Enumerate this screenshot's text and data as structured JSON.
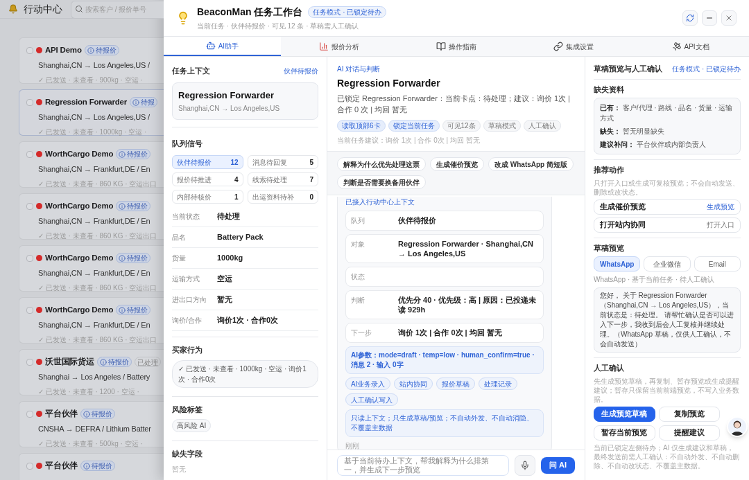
{
  "background": {
    "title": "行动中心",
    "search": {
      "placeholder": "搜索客户 / 报价单号"
    },
    "cards": [
      {
        "name": "API Demo",
        "badge": "待报价",
        "route": "Shanghai,CN → Los Angeles,US /",
        "meta": "✓ 已发送 · 未查看 · 900kg · 空运 ·",
        "selected": false,
        "checked": false
      },
      {
        "name": "Regression Forwarder",
        "badge": "待报",
        "route": "Shanghai,CN → Los Angeles,US /",
        "meta": "✓ 已发送 · 未查看 · 1000kg · 空运 ·",
        "selected": true,
        "checked": false
      },
      {
        "name": "WorthCargo Demo",
        "badge": "待报价",
        "route": "Shanghai,CN → Frankfurt,DE / En",
        "meta": "✓ 已发送 · 未查看 · 860 KG · 空运出口",
        "selected": false,
        "checked": false
      },
      {
        "name": "WorthCargo Demo",
        "badge": "待报价",
        "route": "Shanghai,CN → Frankfurt,DE / En",
        "meta": "✓ 已发送 · 未查看 · 860 KG · 空运出口",
        "selected": false,
        "checked": false
      },
      {
        "name": "WorthCargo Demo",
        "badge": "待报价",
        "route": "Shanghai,CN → Frankfurt,DE / En",
        "meta": "✓ 已发送 · 未查看 · 860 KG · 空运出口",
        "selected": false,
        "checked": false
      },
      {
        "name": "WorthCargo Demo",
        "badge": "待报价",
        "route": "Shanghai,CN → Frankfurt,DE / En",
        "meta": "✓ 已发送 · 未查看 · 860 KG · 空运出口",
        "selected": false,
        "checked": false
      },
      {
        "name": "沃世国际货运",
        "badge": "待报价",
        "extra": "已处理",
        "route": "Shanghai → Los Angeles / Battery",
        "meta": "✓ 已发送 · 未查看 · 1200 · 空运 ·",
        "selected": false,
        "checked": false
      },
      {
        "name": "平台伙伴",
        "badge": "待报价",
        "route": "CNSHA → DEFRA / Lithium Batter",
        "meta": "✓ 已发送 · 未查看 · 500kg · 空运 ·",
        "selected": false,
        "checked": false
      },
      {
        "name": "平台伙伴",
        "badge": "待报价",
        "selected": false,
        "checked": false
      }
    ]
  },
  "header": {
    "title": "BeaconMan 任务工作台",
    "badge": "任务模式 · 已锁定待办",
    "subtitle": "当前任务 · 伙伴待报价 · 可见 12 条 · 草稿需人工确认"
  },
  "tabs": [
    {
      "label": "AI助手",
      "kind": "bot",
      "selected": true
    },
    {
      "label": "报价分析",
      "kind": "chart",
      "selected": false
    },
    {
      "label": "操作指南",
      "kind": "book",
      "selected": false
    },
    {
      "label": "集成设置",
      "kind": "link",
      "selected": false
    },
    {
      "label": "API文档",
      "kind": "satellite",
      "selected": false
    }
  ],
  "context": {
    "title": "任务上下文",
    "link": "伙伴待报价",
    "card": {
      "name": "Regression Forwarder",
      "route": "Shanghai,CN → Los Angeles,US"
    },
    "signals_title": "队列信号",
    "signals": [
      {
        "label": "伙伴待报价",
        "count": "12",
        "selected": true
      },
      {
        "label": "消息待回复",
        "count": "5",
        "selected": false
      },
      {
        "label": "报价待推进",
        "count": "4",
        "selected": false
      },
      {
        "label": "线索待处理",
        "count": "7",
        "selected": false
      },
      {
        "label": "内部待核价",
        "count": "1",
        "selected": false
      },
      {
        "label": "出运资料待补",
        "count": "0",
        "selected": false
      }
    ],
    "fields": [
      {
        "label": "当前状态",
        "value": "待处理"
      },
      {
        "label": "品名",
        "value": "Battery Pack"
      },
      {
        "label": "货量",
        "value": "1000kg"
      },
      {
        "label": "运输方式",
        "value": "空运"
      },
      {
        "label": "进出口方向",
        "value": "暂无"
      },
      {
        "label": "询价/合作",
        "value": "询价1次 · 合作0次"
      }
    ],
    "behavior": {
      "title": "买家行为",
      "chip": "✓ 已发送 · 未查看 · 1000kg · 空运 · 询价1次 · 合作0次"
    },
    "risk": {
      "title": "风险标签",
      "tags": [
        "高风险 AI"
      ]
    },
    "missing": {
      "title": "缺失字段",
      "value": "暂无"
    }
  },
  "chat": {
    "eyebrow": "AI 对话与判断",
    "title": "Regression Forwarder",
    "summary": "已锁定 Regression Forwarder：当前卡点：待处理；建议：询价 1次 | 合作 0 次 | 均回 暂无",
    "chips": [
      {
        "label": "读取顶部6卡",
        "active": true
      },
      {
        "label": "锁定当前任务",
        "active": true
      },
      {
        "label": "可见12条",
        "active": false
      },
      {
        "label": "草稿模式",
        "active": false
      },
      {
        "label": "人工确认",
        "active": false
      }
    ],
    "hint": "当前任务建议：询价 1次 | 合作 0次 | 均回 暂无",
    "prompts": [
      "解释为什么优先处理这票",
      "生成催价预览",
      "改成 WhatsApp 简短版",
      "判断是否需要换备用伙伴"
    ],
    "message": {
      "header": "已接入行动中心上下文",
      "rows": [
        {
          "label": "队列",
          "value": "伙伴待报价"
        },
        {
          "label": "对象",
          "value": "Regression Forwarder · Shanghai,CN → Los Angeles,US"
        },
        {
          "label": "状态"
        },
        {
          "label": "判断",
          "value": "优先分 40 · 优先级：高 | 原因：已投递未读 929h"
        },
        {
          "label": "下一步",
          "value": "询价 1次 | 合作 0次 | 均回 暂无"
        }
      ],
      "params": "AI参数：mode=draft · temp=low · human_confirm=true · 消息 2 · 输入 0字",
      "actions": [
        "AI业务录入",
        "站内协同",
        "报价草稿",
        "处理记录",
        "人工确认写入"
      ],
      "note": "只读上下文；只生成草稿/预览；不自动外发、不自动消隐、不覆盖主数据",
      "time": "刚刚"
    },
    "input": {
      "placeholder": "基于当前待办上下文，帮我解释为什么排第一，并生成下一步预览"
    },
    "send": "问 AI"
  },
  "draft": {
    "title": "草稿预览与人工确认",
    "mode": "任务模式 · 已锁定待办",
    "missing": {
      "title": "缺失资料",
      "lines": [
        {
          "label": "已有：",
          "value": "客户/代理 · 路线 · 品名 · 货量 · 运输方式"
        },
        {
          "label": "缺失：",
          "value": "暂无明显缺失"
        },
        {
          "label": "建议补问：",
          "value": "平台伙伴或内部负责人"
        }
      ]
    },
    "actions": {
      "title": "推荐动作",
      "desc": "只打开入口或生成可复核预览；不会自动发送、删除或改状态。",
      "items": [
        {
          "label": "生成催价预览",
          "action": "生成预览",
          "primary": true
        },
        {
          "label": "打开站内协同",
          "action": "打开入口",
          "primary": false
        }
      ]
    },
    "preview": {
      "title": "草稿预览",
      "channels": [
        {
          "label": "WhatsApp",
          "selected": true
        },
        {
          "label": "企业微信",
          "selected": false
        },
        {
          "label": "Email",
          "selected": false
        }
      ],
      "caption": "WhatsApp · 基于当前任务 · 待人工确认",
      "text": "您好， 关于 Regression Forwarder（Shanghai,CN → Los Angeles,US），当前状态是：待处理。 请帮忙确认是否可以进入下一步，我收到后会人工复核并继续处理。（WhatsApp 草稿，仅供人工确认，不会自动发送）"
    },
    "confirm": {
      "title": "人工确认",
      "desc": "先生成预览草稿，再复制、暂存预览或生成提醒建议；暂存只保留当前前端预览，不写入业务数据。",
      "buttons": [
        {
          "label": "生成预览草稿",
          "primary": true
        },
        {
          "label": "复制预览",
          "primary": false
        },
        {
          "label": "暂存当前预览",
          "primary": false
        },
        {
          "label": "提醒建议",
          "primary": false
        }
      ],
      "footer": "当前已锁定左侧待办；AI 仅生成建议和草稿，最终发送前需人工确认：不自动外发、不自动删除、不自动改状态、不覆盖主数据。"
    }
  }
}
